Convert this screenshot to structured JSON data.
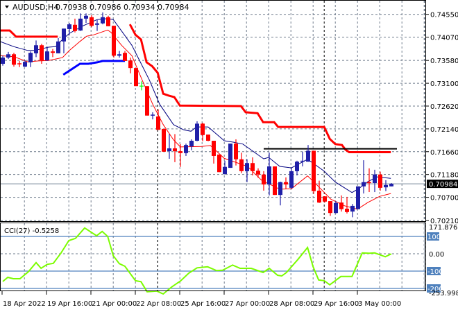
{
  "header": {
    "symbol": "AUDUSD,H4",
    "ohlc": "0.70938 0.70986 0.70934 0.70984"
  },
  "colors": {
    "bull": "#1f1fa8",
    "bear": "#ff0000",
    "doji": "#00ff00",
    "ma_fast": "#000080",
    "ma_slow": "#ff0000",
    "trail_down": "#ff0000",
    "trail_up": "#0000ff",
    "resistance": "#000000",
    "cci": "#7cfc00",
    "grid": "#6e7b8b",
    "level": "#4f81bd"
  },
  "chart_data": [
    {
      "type": "candlestick",
      "title": "AUDUSD,H4 0.70938 0.70986 0.70934 0.70984",
      "ylim": [
        0.7021,
        0.7455
      ],
      "y_tick_labels": [
        "0.74550",
        "0.74070",
        "0.73580",
        "0.73100",
        "0.72620",
        "0.72140",
        "0.71660",
        "0.71180",
        "0.70700",
        "0.70210"
      ],
      "current_price": "0.70984",
      "x_tick_labels": [
        {
          "index": 0,
          "label": "18 Apr 2022"
        },
        {
          "index": 8,
          "label": "19 Apr 16:00"
        },
        {
          "index": 16,
          "label": "21 Apr 00:00"
        },
        {
          "index": 24,
          "label": "22 Apr 08:00"
        },
        {
          "index": 32,
          "label": "25 Apr 16:00"
        },
        {
          "index": 40,
          "label": "27 Apr 00:00"
        },
        {
          "index": 48,
          "label": "28 Apr 08:00"
        },
        {
          "index": 56,
          "label": "29 Apr 16:00"
        },
        {
          "index": 64,
          "label": "3 May 00:00"
        }
      ],
      "period_separators": [
        27.9,
        57.9
      ],
      "candles_ohlc": [
        [
          0.7351,
          0.7368,
          0.7347,
          0.7364
        ],
        [
          0.7364,
          0.7376,
          0.7361,
          0.7371
        ],
        [
          0.7371,
          0.7374,
          0.7345,
          0.7349
        ],
        [
          0.7352,
          0.7357,
          0.7344,
          0.7351
        ],
        [
          0.7345,
          0.7358,
          0.7344,
          0.7355
        ],
        [
          0.7354,
          0.7377,
          0.7344,
          0.7374
        ],
        [
          0.7373,
          0.74,
          0.7365,
          0.739
        ],
        [
          0.739,
          0.7393,
          0.7351,
          0.7358
        ],
        [
          0.7358,
          0.7387,
          0.7357,
          0.7377
        ],
        [
          0.7377,
          0.7382,
          0.7365,
          0.7374
        ],
        [
          0.7373,
          0.7405,
          0.7373,
          0.7398
        ],
        [
          0.7398,
          0.7425,
          0.7373,
          0.7425
        ],
        [
          0.7424,
          0.7437,
          0.7412,
          0.7434
        ],
        [
          0.7433,
          0.7446,
          0.7417,
          0.742
        ],
        [
          0.7421,
          0.7457,
          0.742,
          0.7446
        ],
        [
          0.7446,
          0.7457,
          0.7437,
          0.7452
        ],
        [
          0.7449,
          0.7453,
          0.7428,
          0.7431
        ],
        [
          0.7433,
          0.7443,
          0.742,
          0.7436
        ],
        [
          0.7436,
          0.7459,
          0.7434,
          0.7449
        ],
        [
          0.7449,
          0.7452,
          0.743,
          0.743
        ],
        [
          0.7431,
          0.7431,
          0.7364,
          0.7368
        ],
        [
          0.7368,
          0.7378,
          0.7364,
          0.7371
        ],
        [
          0.7374,
          0.7378,
          0.7357,
          0.7357
        ],
        [
          0.7358,
          0.7364,
          0.7331,
          0.7342
        ],
        [
          0.7342,
          0.7342,
          0.7304,
          0.7304
        ],
        [
          0.7304,
          0.7314,
          0.7295,
          0.7304
        ],
        [
          0.7304,
          0.7304,
          0.7242,
          0.7242
        ],
        [
          0.7242,
          0.7249,
          0.7234,
          0.7244
        ],
        [
          0.724,
          0.7255,
          0.7212,
          0.7212
        ],
        [
          0.7214,
          0.7214,
          0.7166,
          0.7166
        ],
        [
          0.7167,
          0.7203,
          0.7151,
          0.7173
        ],
        [
          0.7173,
          0.7203,
          0.7144,
          0.7167
        ],
        [
          0.7167,
          0.7182,
          0.7134,
          0.7163
        ],
        [
          0.7163,
          0.7183,
          0.7157,
          0.718
        ],
        [
          0.7177,
          0.7192,
          0.7169,
          0.7189
        ],
        [
          0.7189,
          0.723,
          0.7188,
          0.7225
        ],
        [
          0.7225,
          0.7227,
          0.7188,
          0.7201
        ],
        [
          0.7202,
          0.7202,
          0.7188,
          0.7189
        ],
        [
          0.7189,
          0.7189,
          0.7141,
          0.7157
        ],
        [
          0.716,
          0.716,
          0.7123,
          0.7123
        ],
        [
          0.7119,
          0.7147,
          0.7118,
          0.7134
        ],
        [
          0.7132,
          0.7183,
          0.7132,
          0.7183
        ],
        [
          0.7183,
          0.7192,
          0.7137,
          0.715
        ],
        [
          0.715,
          0.7164,
          0.7121,
          0.7125
        ],
        [
          0.7125,
          0.715,
          0.7102,
          0.7142
        ],
        [
          0.7142,
          0.7154,
          0.7116,
          0.7125
        ],
        [
          0.7126,
          0.7131,
          0.7111,
          0.7118
        ],
        [
          0.7118,
          0.7125,
          0.7084,
          0.7097
        ],
        [
          0.7097,
          0.7164,
          0.7074,
          0.7135
        ],
        [
          0.7135,
          0.7135,
          0.7075,
          0.7075
        ],
        [
          0.7075,
          0.7103,
          0.7053,
          0.7102
        ],
        [
          0.7102,
          0.7112,
          0.7087,
          0.7097
        ],
        [
          0.709,
          0.7132,
          0.7088,
          0.7125
        ],
        [
          0.7125,
          0.7147,
          0.7116,
          0.7145
        ],
        [
          0.7145,
          0.7166,
          0.7135,
          0.7147
        ],
        [
          0.7145,
          0.718,
          0.7145,
          0.7168
        ],
        [
          0.7168,
          0.7168,
          0.7077,
          0.7083
        ],
        [
          0.7084,
          0.7105,
          0.7058,
          0.7059
        ],
        [
          0.7072,
          0.7072,
          0.7059,
          0.7061
        ],
        [
          0.7062,
          0.7062,
          0.7031,
          0.7037
        ],
        [
          0.7037,
          0.7062,
          0.7036,
          0.7058
        ],
        [
          0.7059,
          0.7074,
          0.704,
          0.7045
        ],
        [
          0.7046,
          0.7071,
          0.7036,
          0.7039
        ],
        [
          0.704,
          0.7056,
          0.7028,
          0.7052
        ],
        [
          0.7045,
          0.7093,
          0.7045,
          0.7093
        ],
        [
          0.7093,
          0.7148,
          0.7078,
          0.7102
        ],
        [
          0.7102,
          0.7131,
          0.7081,
          0.71
        ],
        [
          0.71,
          0.7128,
          0.7081,
          0.7118
        ],
        [
          0.7118,
          0.7124,
          0.7084,
          0.709
        ],
        [
          0.7091,
          0.7106,
          0.7083,
          0.7096
        ],
        [
          0.7093,
          0.71,
          0.7093,
          0.70984
        ]
      ],
      "ma_fast": [
        [
          -0.5,
          0.7398
        ],
        [
          2,
          0.7387
        ],
        [
          4.5,
          0.7379
        ],
        [
          5.75,
          0.7379
        ],
        [
          8.25,
          0.7386
        ],
        [
          9.5,
          0.7387
        ],
        [
          10.75,
          0.7402
        ],
        [
          12,
          0.7415
        ],
        [
          14.5,
          0.7431
        ],
        [
          17,
          0.7444
        ],
        [
          18.9,
          0.7446
        ],
        [
          19.9,
          0.7444
        ],
        [
          21.4,
          0.742
        ],
        [
          23.25,
          0.739
        ],
        [
          24.5,
          0.7361
        ],
        [
          26.4,
          0.7317
        ],
        [
          28.25,
          0.7266
        ],
        [
          30.75,
          0.7223
        ],
        [
          32.6,
          0.7212
        ],
        [
          33.9,
          0.7209
        ],
        [
          34.9,
          0.7218
        ],
        [
          37,
          0.7218
        ],
        [
          39.9,
          0.7189
        ],
        [
          41.6,
          0.7186
        ],
        [
          43.25,
          0.7182
        ],
        [
          47,
          0.7151
        ],
        [
          47.9,
          0.7154
        ],
        [
          49.9,
          0.7135
        ],
        [
          52,
          0.7132
        ],
        [
          54.9,
          0.715
        ],
        [
          57.9,
          0.7125
        ],
        [
          59.9,
          0.7102
        ],
        [
          62.9,
          0.708
        ],
        [
          64.1,
          0.7088
        ],
        [
          65.75,
          0.7103
        ],
        [
          67.4,
          0.7113
        ],
        [
          69.9,
          0.711
        ]
      ],
      "ma_slow": [
        [
          -0.5,
          0.7368
        ],
        [
          2,
          0.7366
        ],
        [
          4.5,
          0.7355
        ],
        [
          6.4,
          0.7357
        ],
        [
          8.25,
          0.7358
        ],
        [
          10.75,
          0.7364
        ],
        [
          12,
          0.7379
        ],
        [
          13.9,
          0.7398
        ],
        [
          15.1,
          0.7409
        ],
        [
          16.4,
          0.7412
        ],
        [
          18.9,
          0.7422
        ],
        [
          19.5,
          0.7417
        ],
        [
          21.4,
          0.739
        ],
        [
          23.25,
          0.7368
        ],
        [
          25.1,
          0.7317
        ],
        [
          27,
          0.7266
        ],
        [
          28.9,
          0.7223
        ],
        [
          30.75,
          0.7191
        ],
        [
          32,
          0.7176
        ],
        [
          35.75,
          0.7177
        ],
        [
          37.4,
          0.7179
        ],
        [
          39.9,
          0.7152
        ],
        [
          44.1,
          0.7135
        ],
        [
          46.6,
          0.7106
        ],
        [
          49.9,
          0.7087
        ],
        [
          52,
          0.7088
        ],
        [
          54.9,
          0.7115
        ],
        [
          56.6,
          0.7096
        ],
        [
          59.1,
          0.7066
        ],
        [
          61.6,
          0.7052
        ],
        [
          63.9,
          0.7045
        ],
        [
          65.75,
          0.7059
        ],
        [
          67.9,
          0.7072
        ],
        [
          69.9,
          0.7078
        ]
      ],
      "trail_down": [
        [
          [
            -0.5,
            0.7421
          ],
          [
            1.25,
            0.7421
          ],
          [
            2.4,
            0.7408
          ],
          [
            9.9,
            0.7408
          ]
        ],
        [
          [
            22.9,
            0.7434
          ],
          [
            23.9,
            0.7412
          ],
          [
            24.9,
            0.7402
          ],
          [
            25.9,
            0.7354
          ],
          [
            26.9,
            0.7346
          ],
          [
            27.9,
            0.7332
          ],
          [
            28.9,
            0.7288
          ],
          [
            29.9,
            0.7284
          ],
          [
            30.9,
            0.7281
          ],
          [
            31.9,
            0.7263
          ],
          [
            42.9,
            0.7262
          ],
          [
            43.75,
            0.7249
          ],
          [
            45.9,
            0.7247
          ],
          [
            46.9,
            0.7228
          ],
          [
            48.9,
            0.7228
          ],
          [
            49.6,
            0.7218
          ],
          [
            57.9,
            0.7218
          ],
          [
            58.9,
            0.7193
          ],
          [
            59.9,
            0.7182
          ],
          [
            61.1,
            0.718
          ],
          [
            61.75,
            0.717
          ],
          [
            62.4,
            0.7165
          ],
          [
            69.9,
            0.7165
          ]
        ]
      ],
      "trail_up": [
        [
          10.9,
          0.7328
        ],
        [
          13.9,
          0.7351
        ],
        [
          15.4,
          0.7351
        ],
        [
          17,
          0.7354
        ],
        [
          18,
          0.7357
        ],
        [
          22,
          0.7357
        ]
      ],
      "resistance_line": {
        "from_index": 47,
        "to_index": 71,
        "price": 0.7172
      }
    },
    {
      "type": "line",
      "title": "CCI(27) -0.5258",
      "ylim": [
        -253.9982,
        171.8765
      ],
      "y_tick_labels": {
        "max": "171.8765",
        "min": "-253.9982",
        "zero": "0.00",
        "levels": [
          "100",
          "-100",
          "-200"
        ]
      },
      "level_values": [
        100,
        -100,
        -200
      ],
      "values": [
        [
          0,
          -160
        ],
        [
          0.9,
          -136
        ],
        [
          1.9,
          -144
        ],
        [
          3.1,
          -144
        ],
        [
          4.6,
          -104
        ],
        [
          6,
          -51
        ],
        [
          6.9,
          -84
        ],
        [
          8,
          -61
        ],
        [
          9.1,
          -55
        ],
        [
          10.5,
          5
        ],
        [
          11.9,
          76
        ],
        [
          13.1,
          89
        ],
        [
          14.75,
          149
        ],
        [
          16.9,
          104
        ],
        [
          17.9,
          129
        ],
        [
          18.9,
          100
        ],
        [
          19.9,
          -11
        ],
        [
          21,
          -57
        ],
        [
          22,
          -72
        ],
        [
          23.9,
          -155
        ],
        [
          24.9,
          -161
        ],
        [
          26,
          -219
        ],
        [
          27.75,
          -215
        ],
        [
          28.9,
          -232
        ],
        [
          30.4,
          -192
        ],
        [
          32,
          -157
        ],
        [
          33.5,
          -112
        ],
        [
          35,
          -81
        ],
        [
          36.9,
          -75
        ],
        [
          38.5,
          -97
        ],
        [
          39.6,
          -95
        ],
        [
          41.4,
          -65
        ],
        [
          42.75,
          -84
        ],
        [
          44.75,
          -84
        ],
        [
          46.9,
          -108
        ],
        [
          48,
          -84
        ],
        [
          49.5,
          -124
        ],
        [
          50.25,
          -128
        ],
        [
          51.1,
          -108
        ],
        [
          53.1,
          -35
        ],
        [
          54.9,
          36
        ],
        [
          55.9,
          -75
        ],
        [
          56.9,
          -151
        ],
        [
          57.9,
          -155
        ],
        [
          58.9,
          -179
        ],
        [
          60.9,
          -131
        ],
        [
          62.9,
          -131
        ],
        [
          64.75,
          5
        ],
        [
          66,
          3
        ],
        [
          67,
          5
        ],
        [
          68.9,
          -17
        ],
        [
          70,
          -0.5258
        ]
      ]
    }
  ]
}
